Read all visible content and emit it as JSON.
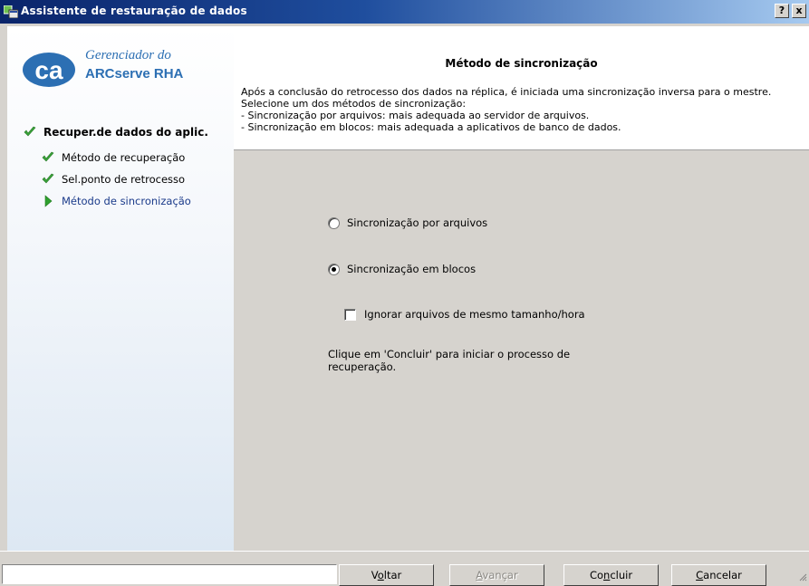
{
  "window": {
    "title": "Assistente de restauração de dados",
    "help_label": "?",
    "close_label": "x"
  },
  "logo": {
    "line1": "Gerenciador do",
    "line2": "ARCserve RHA",
    "mark_text": "ca",
    "brand_color": "#2c6fb3"
  },
  "steps": {
    "main": {
      "label": "Recuper.de dados do aplic.",
      "icon": "check-icon"
    },
    "items": [
      {
        "label": "Método de recuperação",
        "icon": "check-icon"
      },
      {
        "label": "Sel.ponto de retrocesso",
        "icon": "check-icon"
      },
      {
        "label": "Método de sincronização",
        "icon": "arrow-right-icon",
        "active": true
      }
    ]
  },
  "header": {
    "title": "Método de sincronização",
    "description": "Após a conclusão do retrocesso dos dados na réplica, é iniciada uma sincronização inversa para o mestre.\nSelecione um dos métodos de sincronização:\n- Sincronização por arquivos: mais adequada ao servidor de arquivos.\n- Sincronização em blocos: mais adequada a aplicativos de banco de dados."
  },
  "options": {
    "file_sync": {
      "label": "Sincronização por arquivos",
      "checked": false
    },
    "block_sync": {
      "label": "Sincronização em blocos",
      "checked": true
    },
    "ignore_same": {
      "label": "Ignorar arquivos de mesmo tamanho/hora",
      "checked": false
    }
  },
  "note": "Clique em 'Concluir' para iniciar o processo de recuperação.",
  "buttons": {
    "back": {
      "prefix": "V",
      "ul": "o",
      "suffix": "ltar"
    },
    "next": {
      "prefix": "",
      "ul": "A",
      "suffix": "vançar",
      "disabled": true
    },
    "finish": {
      "prefix": "Co",
      "ul": "n",
      "suffix": "cluir"
    },
    "cancel": {
      "prefix": "",
      "ul": "C",
      "suffix": "ancelar"
    }
  },
  "colors": {
    "check": "#3aa43a",
    "arrow": "#2fa02f",
    "active_text": "#1a3a8a",
    "titlebar_start": "#0a246a",
    "titlebar_end": "#a6caf0"
  }
}
